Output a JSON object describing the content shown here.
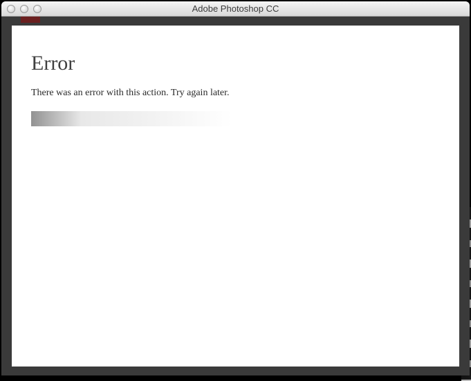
{
  "window": {
    "title": "Adobe Photoshop CC"
  },
  "error": {
    "heading": "Error",
    "message": "There was an error with this action. Try again later."
  }
}
